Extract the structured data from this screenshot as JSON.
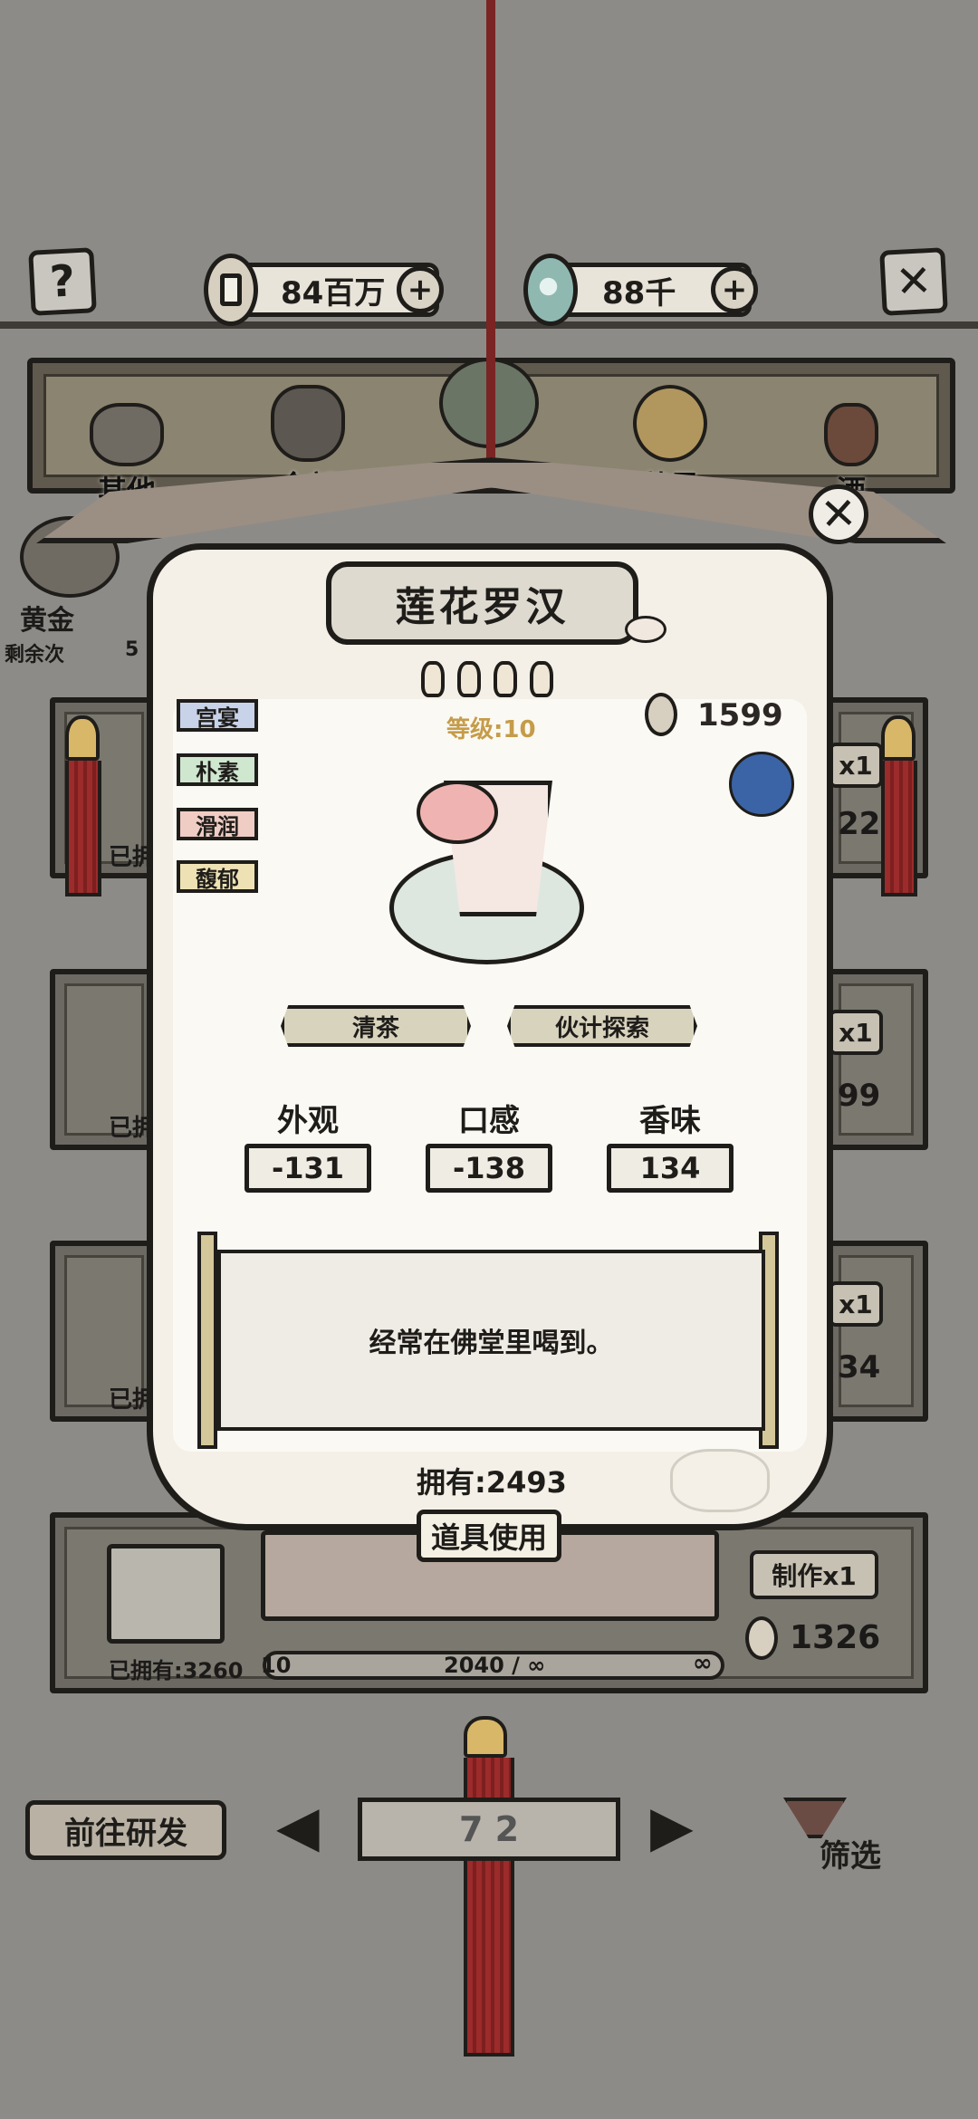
{
  "top_bar": {
    "help_icon": "?",
    "close_icon": "✕",
    "coins": "84百万",
    "gems": "88千",
    "plus": "+"
  },
  "categories": [
    {
      "label": "其他",
      "icon": "bowl-icon"
    },
    {
      "label": "全部",
      "icon": "pig-icon"
    },
    {
      "label": "",
      "icon": "teapot-icon"
    },
    {
      "label": "茶果",
      "icon": "snack-icon"
    },
    {
      "label": "酒",
      "icon": "wine-icon"
    }
  ],
  "background_list": {
    "golden_label": "黄金",
    "remaining_label": "剩余次",
    "remaining_suffix": "5",
    "owned_partial": "已拥",
    "card_right_values": [
      "x1",
      "22",
      "x1",
      "99",
      "x1",
      "34"
    ],
    "bottom_card": {
      "owned": "已拥有:3260",
      "make_button": "制作x1",
      "price": "1326",
      "progress_left": "10",
      "progress_text": "2040 / ∞",
      "progress_right": "∞"
    }
  },
  "detail": {
    "name": "莲花罗汉",
    "stars": 4,
    "level": "等级:10",
    "price": "1599",
    "tags": [
      {
        "label": "宫宴",
        "color": "#c8d3ea"
      },
      {
        "label": "朴素",
        "color": "#cfe6cf"
      },
      {
        "label": "滑润",
        "color": "#efcdc4"
      },
      {
        "label": "馥郁",
        "color": "#eee2b4"
      }
    ],
    "categories": [
      "清茶",
      "伙计探索"
    ],
    "stats": [
      {
        "label": "外观",
        "value": "-131"
      },
      {
        "label": "口感",
        "value": "-138"
      },
      {
        "label": "香味",
        "value": "134"
      }
    ],
    "description": "经常在佛堂里喝到。",
    "owned": "拥有:2493",
    "use_button": "道具使用",
    "close_icon": "✕"
  },
  "bottom_bar": {
    "research_button": "前往研发",
    "page_partial": "7 2",
    "filter_label": "筛选",
    "prev_arrow": "◀",
    "next_arrow": "▶"
  }
}
